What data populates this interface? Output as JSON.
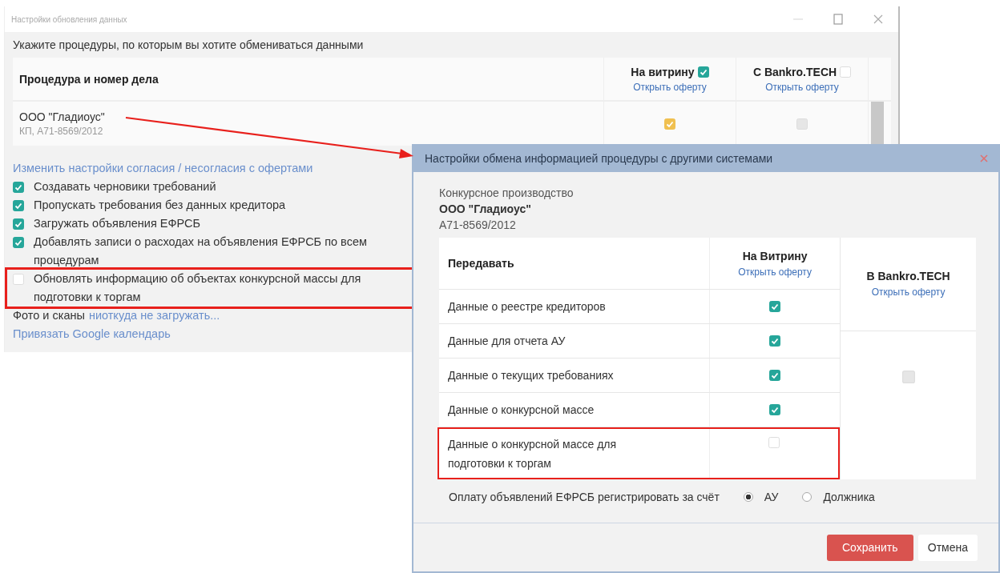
{
  "back_window": {
    "title": "Настройки обновления данных",
    "prompt": "Укажите процедуры, по которым вы хотите обмениваться данными",
    "table": {
      "columns": [
        {
          "label": "Процедура и номер дела"
        },
        {
          "label": "На витрину",
          "checked": true,
          "link": "Открыть оферту"
        },
        {
          "label": "С Bankro.TECH",
          "checked": false,
          "link": "Открыть оферту"
        }
      ],
      "rows": [
        {
          "name": "ООО \"Гладиоус\"",
          "case": "КП, А71-8569/2012",
          "cells": [
            {
              "checked": true,
              "disabled": true
            },
            {
              "checked": false,
              "disabled": true
            }
          ]
        }
      ]
    },
    "consent_link": "Изменить настройки согласия / несогласия с офертами",
    "options": [
      {
        "label": "Создавать черновики требований",
        "checked": true,
        "highlighted": false
      },
      {
        "label": "Пропускать требования без данных кредитора",
        "checked": true,
        "highlighted": false
      },
      {
        "label": "Загружать объявления ЕФРСБ",
        "checked": true,
        "highlighted": false
      },
      {
        "label": "Добавлять записи о расходах на объявления ЕФРСБ по всем процедурам",
        "checked": true,
        "highlighted": false
      },
      {
        "label": "Обновлять информацию об объектах конкурсной массы для подготовки к торгам",
        "checked": false,
        "highlighted": true
      }
    ],
    "photos": {
      "label": "Фото и сканы",
      "link": "ниоткуда не загружать..."
    },
    "calendar_link": "Привязать Google календарь"
  },
  "dialog": {
    "title": "Настройки обмена информацией процедуры с другими системами",
    "procedure_type": "Конкурсное производство",
    "debtor": "ООО \"Гладиоус\"",
    "case_number": "А71-8569/2012",
    "table": {
      "columns": [
        {
          "label": "Передавать"
        },
        {
          "label": "На Витрину",
          "link": "Открыть оферту"
        },
        {
          "label": "В Bankro.TECH",
          "link": "Открыть оферту"
        }
      ],
      "rows": [
        {
          "label": "Данные о реестре кредиторов",
          "checked": true,
          "highlighted": false
        },
        {
          "label": "Данные для отчета АУ",
          "checked": true,
          "highlighted": false
        },
        {
          "label": "Данные о текущих требованиях",
          "checked": true,
          "highlighted": false
        },
        {
          "label": "Данные о конкурсной массе",
          "checked": true,
          "highlighted": false
        },
        {
          "label": "Данные о конкурсной массе для подготовки к торгам",
          "checked": false,
          "highlighted": true
        }
      ],
      "bankro": {
        "checked": false,
        "disabled": true
      }
    },
    "payment": {
      "label": "Оплату объявлений ЕФРСБ регистрировать за счёт",
      "options": [
        {
          "label": "АУ",
          "selected": true
        },
        {
          "label": "Должника",
          "selected": false
        }
      ]
    },
    "buttons": [
      {
        "label": "Сохранить",
        "kind": "primary"
      },
      {
        "label": "Отмена",
        "kind": "secondary"
      }
    ]
  }
}
